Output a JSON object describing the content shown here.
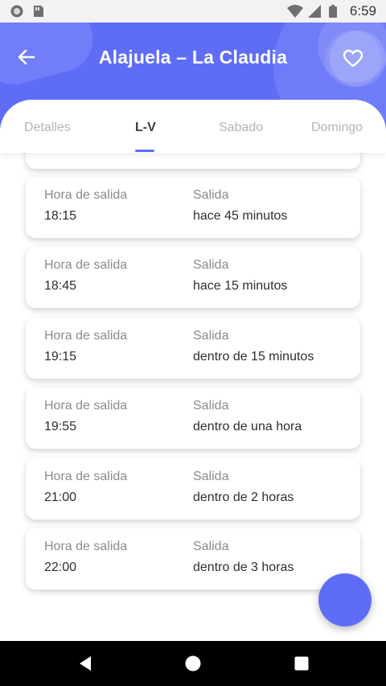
{
  "status_bar": {
    "time": "6:59"
  },
  "header": {
    "title": "Alajuela – La Claudia",
    "back_icon": "arrow-left-icon",
    "favorite_icon": "heart-outline-icon"
  },
  "tabs": [
    {
      "label": "Detalles",
      "active": false
    },
    {
      "label": "L-V",
      "active": true
    },
    {
      "label": "Sabado",
      "active": false
    },
    {
      "label": "Domingo",
      "active": false
    }
  ],
  "schedule": [
    {
      "hora_label": "Hora de salida",
      "hora": "18:15",
      "salida_label": "Salida",
      "salida": "hace 45 minutos"
    },
    {
      "hora_label": "Hora de salida",
      "hora": "18:45",
      "salida_label": "Salida",
      "salida": "hace 15 minutos"
    },
    {
      "hora_label": "Hora de salida",
      "hora": "19:15",
      "salida_label": "Salida",
      "salida": "dentro de 15 minutos"
    },
    {
      "hora_label": "Hora de salida",
      "hora": "19:55",
      "salida_label": "Salida",
      "salida": "dentro de una hora"
    },
    {
      "hora_label": "Hora de salida",
      "hora": "21:00",
      "salida_label": "Salida",
      "salida": "dentro de 2 horas"
    },
    {
      "hora_label": "Hora de salida",
      "hora": "22:00",
      "salida_label": "Salida",
      "salida": "dentro de 3 horas"
    }
  ],
  "colors": {
    "accent": "#5f6df6",
    "status_bar": "#f2f2f2",
    "nav_bar": "#000000"
  }
}
